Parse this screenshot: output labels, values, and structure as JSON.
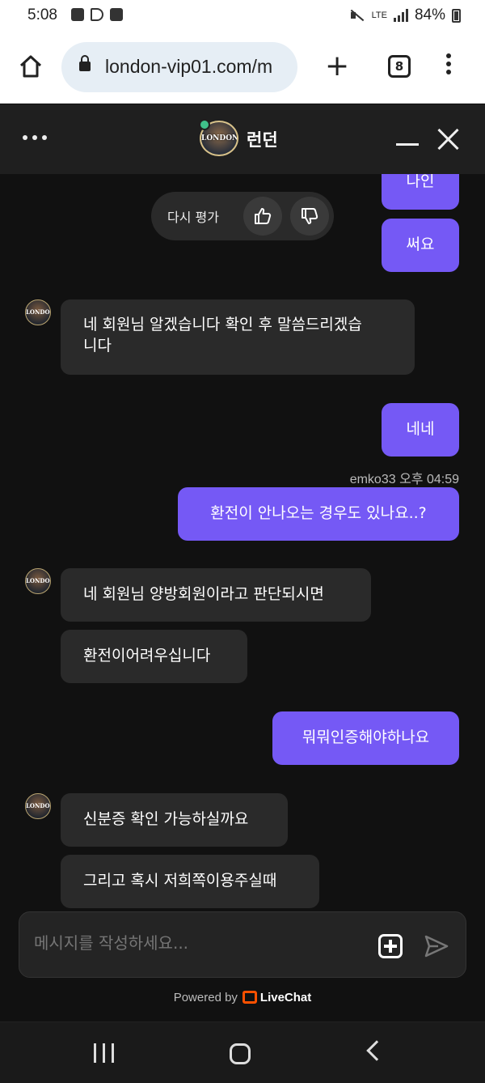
{
  "status_bar": {
    "time": "5:08",
    "network": "LTE",
    "battery": "84%"
  },
  "browser": {
    "url": "london-vip01.com/m",
    "tab_count": "8",
    "new_tab_label": "+",
    "icons": [
      "home-icon",
      "lock-icon",
      "plus-icon",
      "tabs-icon",
      "more-vertical-icon"
    ]
  },
  "chat_header": {
    "title": "런던",
    "avatar_text": "LONDON",
    "online": true
  },
  "rating": {
    "label": "다시 평가"
  },
  "messages": [
    {
      "from": "me",
      "text": "나인"
    },
    {
      "from": "me",
      "text": "써요"
    },
    {
      "from": "them",
      "text": "네 회원님 알겠습니다 확인 후 말씀드리겠습\n니다"
    },
    {
      "from": "me",
      "text": "네네"
    },
    {
      "from": "me",
      "meta": "emko33 오후 04:59",
      "text": "환전이 안나오는 경우도 있나요..?"
    },
    {
      "from": "them",
      "text": "네 회원님 양방회원이라고 판단되시면"
    },
    {
      "from": "them",
      "text": "환전이어려우십니다"
    },
    {
      "from": "me",
      "text": "뭐뭐인증해야하나요"
    },
    {
      "from": "them",
      "text": "신분증 확인 가능하실까요"
    },
    {
      "from": "them",
      "text": "그리고 혹시 저희쪽이용주실때"
    }
  ],
  "composer": {
    "placeholder": "메시지를 작성하세요..."
  },
  "footer": {
    "powered_by": "Powered by",
    "brand": "LiveChat"
  },
  "colors": {
    "my_bubble": "#7559f5",
    "their_bubble": "#2a2a2a",
    "background": "#111111",
    "online": "#3fc08a",
    "livechat_brand": "#ff5100"
  }
}
